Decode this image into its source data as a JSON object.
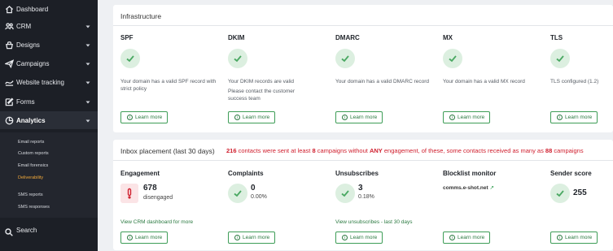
{
  "sidebar": {
    "items": [
      {
        "label": "Dashboard",
        "icon": "home-icon"
      },
      {
        "label": "CRM",
        "icon": "people-icon"
      },
      {
        "label": "Designs",
        "icon": "palette-icon"
      },
      {
        "label": "Campaigns",
        "icon": "send-icon"
      },
      {
        "label": "Website tracking",
        "icon": "tracking-icon"
      },
      {
        "label": "Forms",
        "icon": "edit-icon"
      },
      {
        "label": "Analytics",
        "icon": "analytics-icon"
      }
    ],
    "sub_items": [
      "Email reports",
      "Custom reports",
      "Email forensics",
      "Deliverability",
      "SMS reports",
      "SMS responses"
    ],
    "active_sub": "Deliverability",
    "search_label": "Search"
  },
  "infrastructure": {
    "title": "Infrastructure",
    "columns": [
      {
        "title": "SPF",
        "desc": "Your domain has a valid SPF record with strict policy",
        "desc2": ""
      },
      {
        "title": "DKIM",
        "desc": "Your DKIM records are valid",
        "desc2": "Please contact the customer success team"
      },
      {
        "title": "DMARC",
        "desc": "Your domain has a valid DMARC record",
        "desc2": ""
      },
      {
        "title": "MX",
        "desc": "Your domain has a valid MX record",
        "desc2": ""
      },
      {
        "title": "TLS",
        "desc": "TLS configured (1.2)",
        "desc2": ""
      }
    ],
    "learn_more": "Learn more"
  },
  "inbox": {
    "title": "Inbox placement (last 30 days)",
    "msg_contacts": "216",
    "msg_part1": " contacts were sent at least ",
    "msg_count": "8",
    "msg_part2": " campaigns without ",
    "msg_any": "ANY",
    "msg_part3": " engagement, of these, some contacts received as many as ",
    "msg_max": "88",
    "msg_part4": " campaigns",
    "engagement": {
      "title": "Engagement",
      "value": "678",
      "sub": "disengaged",
      "link": "View CRM dashboard for more"
    },
    "complaints": {
      "title": "Complaints",
      "value": "0",
      "sub": "0.00%"
    },
    "unsubscribes": {
      "title": "Unsubscribes",
      "value": "3",
      "sub": "0.18%",
      "link": "View unsubscribes - last 30 days"
    },
    "blocklist": {
      "title": "Blocklist monitor",
      "domain": "comms.e-shot.net"
    },
    "sender": {
      "title": "Sender score",
      "value": "255"
    },
    "learn_more": "Learn more"
  },
  "colors": {
    "accent_green": "#3e9d57",
    "alert_red": "#d0202f",
    "sidebar_bg": "#1c1f26",
    "active_sub": "#f0a83a"
  }
}
